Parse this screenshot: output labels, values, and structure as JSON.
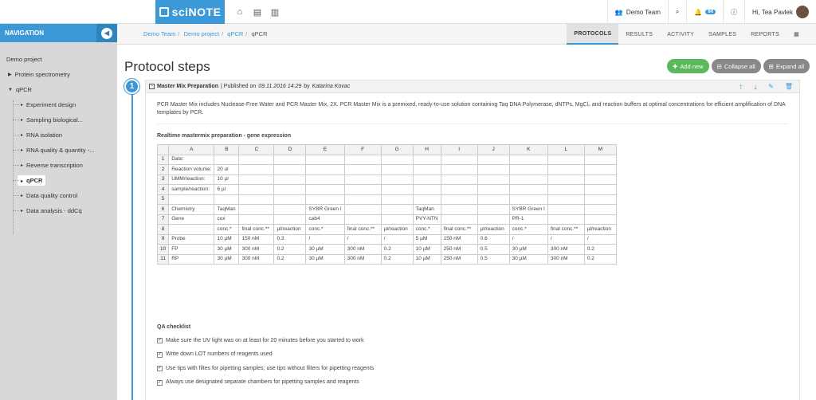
{
  "top": {
    "logo": "sciNOTE",
    "team": "Demo Team",
    "notif_count": "64",
    "user": "Hi, Tea Pavlek"
  },
  "nav": {
    "title": "NAVIGATION",
    "project": "Demo project",
    "exp1": "Protein spectrometry",
    "exp2": "qPCR",
    "tasks": [
      "Experiment design",
      "Sampling biological...",
      "RNA isolation",
      "RNA quality & quantity -...",
      "Reverse transcription",
      "qPCR",
      "Data quality control",
      "Data analysis - ddCq"
    ]
  },
  "breadcrumb": [
    "Demo Team",
    "Demo project",
    "qPCR",
    "qPCR"
  ],
  "tabs": [
    "PROTOCOLS",
    "RESULTS",
    "ACTIVITY",
    "SAMPLES",
    "REPORTS"
  ],
  "page": {
    "title": "Protocol steps",
    "add": "Add new",
    "collapse": "Collapse all",
    "expand": "Expand all"
  },
  "step": {
    "number": "1",
    "name": "Master Mix Preparation",
    "published_prefix": "| Published on",
    "date": "09.11.2016 14:29",
    "by": "by",
    "author": "Katarina Kovac",
    "description": "PCR Master Mix includes Nuclease-Free Water and PCR Master Mix, 2X. PCR Master Mix is a premixed, ready-to-use solution containing Taq DNA Polymerase, dNTPs, MgCl₂ and reaction buffers at optimal concentrations for efficient amplification of DNA templates by PCR.",
    "table_title": "Realtime mastermix preparation - gene expression",
    "columns": [
      "",
      "A",
      "B",
      "C",
      "D",
      "E",
      "F",
      "G",
      "H",
      "I",
      "J",
      "K",
      "L",
      "M"
    ],
    "rows": [
      [
        "1",
        "Date:",
        "",
        "",
        "",
        "",
        "",
        "",
        "",
        "",
        "",
        "",
        "",
        ""
      ],
      [
        "2",
        "Reaction volume:",
        "20 ul",
        "",
        "",
        "",
        "",
        "",
        "",
        "",
        "",
        "",
        "",
        ""
      ],
      [
        "3",
        "UMM/reaction:",
        "10 µl",
        "",
        "",
        "",
        "",
        "",
        "",
        "",
        "",
        "",
        "",
        ""
      ],
      [
        "4",
        "sample/reaction:",
        "6 µl",
        "",
        "",
        "",
        "",
        "",
        "",
        "",
        "",
        "",
        "",
        ""
      ],
      [
        "5",
        "",
        "",
        "",
        "",
        "",
        "",
        "",
        "",
        "",
        "",
        "",
        "",
        ""
      ],
      [
        "6",
        "Chemistry",
        "TaqMan",
        "",
        "",
        "SYBR Green I",
        "",
        "",
        "TaqMan",
        "",
        "",
        "SYBR Green I",
        "",
        ""
      ],
      [
        "7",
        "Gene",
        "cox",
        "",
        "",
        "cab4",
        "",
        "",
        "PVY-NTN",
        "",
        "",
        "PR-1",
        "",
        ""
      ],
      [
        "8",
        "",
        "conc.*",
        "final conc.**",
        "µl/reaction",
        "conc.*",
        "final conc.**",
        "µl/reaction",
        "conc.*",
        "final conc.**",
        "µl/reaction",
        "conc.*",
        "final conc.**",
        "µl/reaction"
      ],
      [
        "9",
        "Probe",
        "10 µM",
        "150 nM",
        "0.3",
        "/",
        "/",
        "/",
        "5 µM",
        "150 nM",
        "0.6",
        "/",
        "/",
        "/"
      ],
      [
        "10",
        "FP",
        "30 µM",
        "300 nM",
        "0.2",
        "30 µM",
        "300 nM",
        "0.2",
        "10 µM",
        "250 nM",
        "0.5",
        "30 µM",
        "300 nM",
        "0.2"
      ],
      [
        "11",
        "RP",
        "30 µM",
        "300 nM",
        "0.2",
        "30 µM",
        "300 nM",
        "0.2",
        "10 µM",
        "250 nM",
        "0.5",
        "30 µM",
        "300 nM",
        "0.2"
      ]
    ],
    "qa_title": "QA checklist",
    "checklist": [
      "Make sure the UV light was on at least for 20 minutes before you started to work",
      "Write down LOT numbers of reagents used",
      "Use tips with filtes for pipetting samples; use tips without filters for pipetting reagents",
      "Always use designated separate chambers for pipetting samples and reagents"
    ]
  },
  "colors": {
    "accent": "#3b99d8",
    "green": "#5cb85c",
    "sidebar": "#d8d8d8"
  }
}
